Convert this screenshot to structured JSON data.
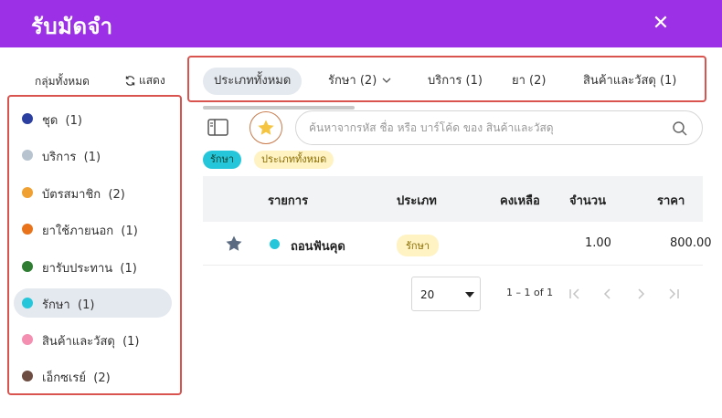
{
  "header": {
    "title": "รับมัดจำ",
    "close_icon": "close-icon",
    "bg_color": "#9b30e6"
  },
  "sidebar": {
    "all_groups_label": "กลุ่มทั้งหมด",
    "show_label": "แสดง",
    "items": [
      {
        "label": "ชุด",
        "count": "(1)",
        "color": "#2b3fa0"
      },
      {
        "label": "บริการ",
        "count": "(1)",
        "color": "#b7c3cf"
      },
      {
        "label": "บัตรสมาชิก",
        "count": "(2)",
        "color": "#f0a030"
      },
      {
        "label": "ยาใช้ภายนอก",
        "count": "(1)",
        "color": "#e8731a"
      },
      {
        "label": "ยารับประทาน",
        "count": "(1)",
        "color": "#2e7d32"
      },
      {
        "label": "รักษา",
        "count": "(1)",
        "color": "#26c6da",
        "active": true
      },
      {
        "label": "สินค้าและวัสดุ",
        "count": "(1)",
        "color": "#f48fb1"
      },
      {
        "label": "เอ็กซเรย์",
        "count": "(2)",
        "color": "#6d4c41"
      }
    ]
  },
  "tabs": [
    {
      "label": "ประเภททั้งหมด",
      "active": true
    },
    {
      "label": "รักษา (2)",
      "has_dropdown": true
    },
    {
      "label": "บริการ (1)"
    },
    {
      "label": "ยา (2)"
    },
    {
      "label": "สินค้าและวัสดุ (1)"
    }
  ],
  "search": {
    "placeholder": "ค้นหาจากรหัส ชื่อ หรือ บาร์โค้ด ของ สินค้าและวัสดุ",
    "value": ""
  },
  "filters": [
    "รักษา",
    "ประเภททั้งหมด"
  ],
  "table": {
    "columns": [
      "รายการ",
      "ประเภท",
      "คงเหลือ",
      "จำนวน",
      "ราคา"
    ],
    "rows": [
      {
        "name": "ถอนฟันคุด",
        "type": "รักษา",
        "stock": "",
        "qty": "1.00",
        "price": "800.00",
        "dot_color": "#26c6da"
      }
    ]
  },
  "pagination": {
    "page_size": "20",
    "range": "1 – 1 of 1"
  },
  "colors": {
    "accent": "#9b30e6",
    "highlight_border": "#d9534f",
    "star": "#f5c542"
  }
}
